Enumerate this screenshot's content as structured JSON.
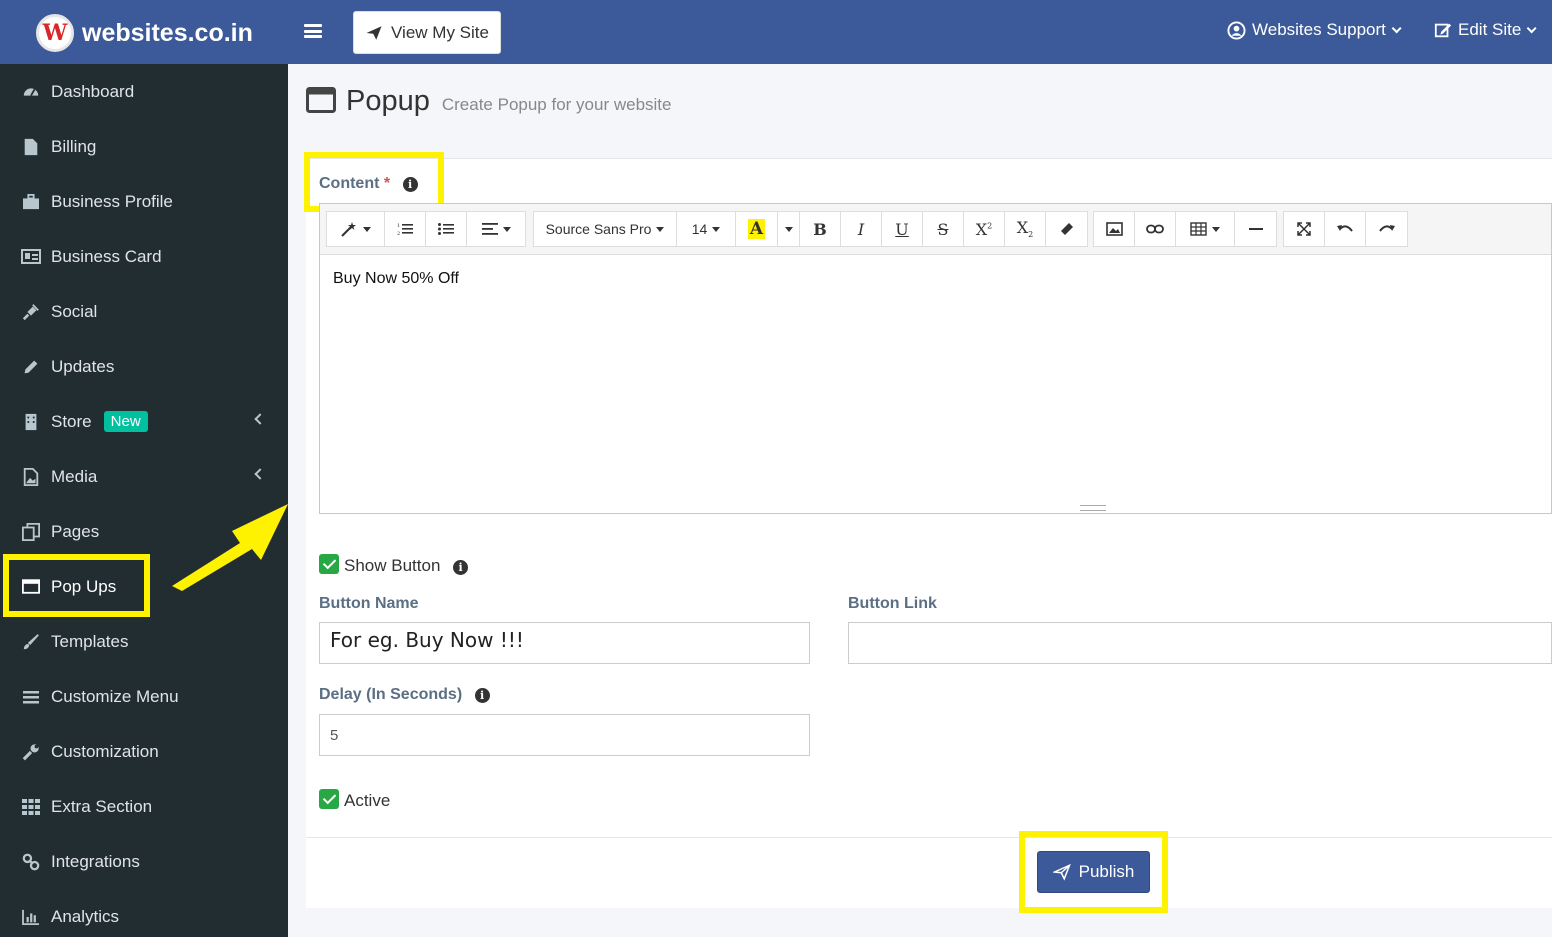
{
  "brand": {
    "name": "websites.co.in",
    "logo_letter": "W"
  },
  "header": {
    "view_site_label": "View My Site",
    "support_label": "Websites Support",
    "edit_site_label": "Edit Site"
  },
  "sidebar": {
    "items": [
      {
        "label": "Dashboard",
        "icon": "dashboard-icon"
      },
      {
        "label": "Billing",
        "icon": "file-icon"
      },
      {
        "label": "Business Profile",
        "icon": "briefcase-icon"
      },
      {
        "label": "Business Card",
        "icon": "id-card-icon"
      },
      {
        "label": "Social",
        "icon": "plug-icon"
      },
      {
        "label": "Updates",
        "icon": "pencil-icon"
      },
      {
        "label": "Store",
        "icon": "building-icon",
        "badge": "New"
      },
      {
        "label": "Media",
        "icon": "image-icon"
      },
      {
        "label": "Pages",
        "icon": "copy-icon"
      },
      {
        "label": "Pop Ups",
        "icon": "window-icon"
      },
      {
        "label": "Templates",
        "icon": "brush-icon"
      },
      {
        "label": "Customize Menu",
        "icon": "bars-icon"
      },
      {
        "label": "Customization",
        "icon": "wrench-icon"
      },
      {
        "label": "Extra Section",
        "icon": "grid-icon"
      },
      {
        "label": "Integrations",
        "icon": "link-icon"
      },
      {
        "label": "Analytics",
        "icon": "bar-chart-icon"
      }
    ]
  },
  "page": {
    "title": "Popup",
    "subtitle": "Create Popup for your website"
  },
  "form": {
    "content_label": "Content",
    "required_mark": "*",
    "editor": {
      "font_family": "Source Sans Pro",
      "font_size": "14",
      "body_text": "Buy Now 50% Off"
    },
    "show_button_label": "Show Button",
    "show_button_checked": true,
    "button_name_label": "Button Name",
    "button_name_placeholder": "For eg. Buy Now !!!",
    "button_link_label": "Button Link",
    "button_link_value": "",
    "delay_label": "Delay (In Seconds)",
    "delay_value": "5",
    "active_label": "Active",
    "active_checked": true,
    "publish_label": "Publish"
  },
  "colors": {
    "header_bg": "#3c5a99",
    "sidebar_bg": "#222d32",
    "highlight": "#fff200",
    "badge": "#00c0a0",
    "checkbox": "#28a745"
  }
}
